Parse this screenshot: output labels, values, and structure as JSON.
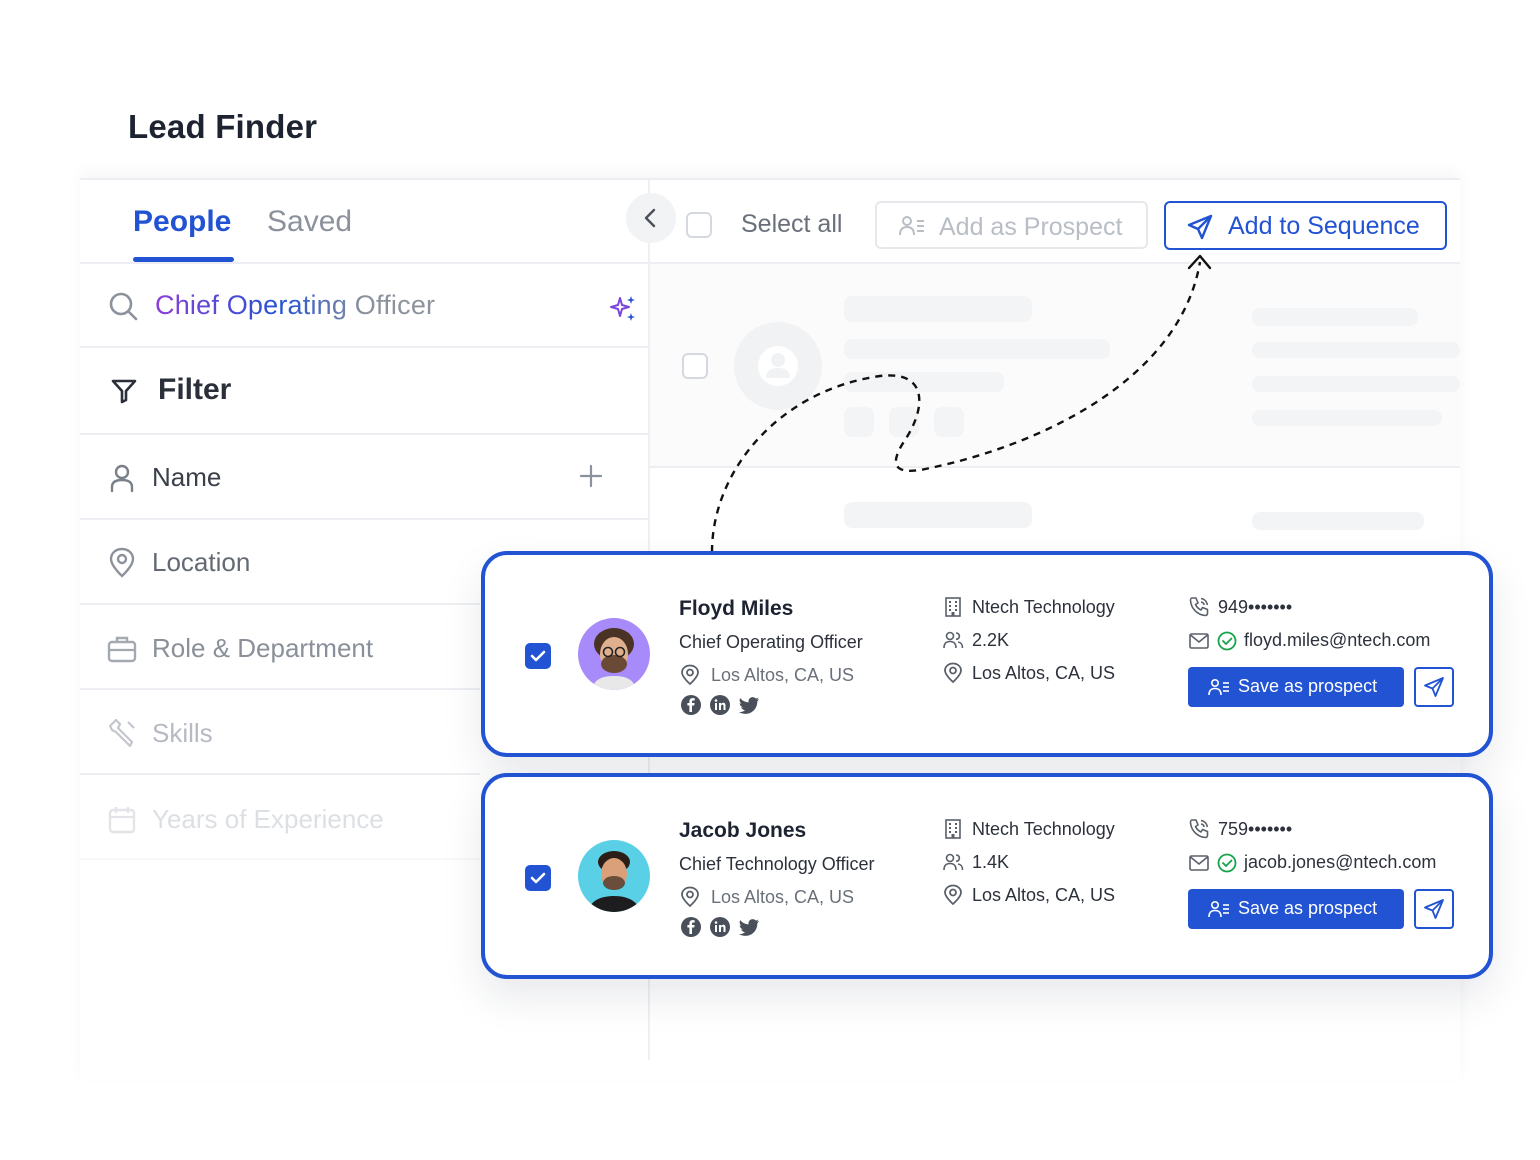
{
  "page": {
    "title": "Lead Finder"
  },
  "tabs": [
    {
      "label": "People",
      "active": true
    },
    {
      "label": "Saved",
      "active": false
    }
  ],
  "search": {
    "value": "Chief Operating Officer",
    "gradient_from": "#8b3fd9",
    "gradient_to": "#2253d3",
    "icon": "search-icon"
  },
  "filter": {
    "label": "Filter",
    "items": [
      {
        "label": "Name",
        "icon": "person-icon"
      },
      {
        "label": "Location",
        "icon": "location-pin-icon"
      },
      {
        "label": "Role & Department",
        "icon": "briefcase-icon"
      },
      {
        "label": "Skills",
        "icon": "tools-icon"
      },
      {
        "label": "Years of Experience",
        "icon": "calendar-icon"
      }
    ]
  },
  "toolbar": {
    "select_all": "Select all",
    "add_prospect": "Add as Prospect",
    "add_sequence": "Add to Sequence"
  },
  "leads": [
    {
      "name": "Floyd Miles",
      "title": "Chief Operating Officer",
      "location": "Los Altos, CA, US",
      "company": "Ntech Technology",
      "employees": "2.2K",
      "company_location": "Los Altos, CA, US",
      "phone": "949•••••••",
      "email": "floyd.miles@ntech.com",
      "save_label": "Save as prospect",
      "avatar_bg": "#a78bfa",
      "checked": true
    },
    {
      "name": "Jacob Jones",
      "title": "Chief Technology Officer",
      "location": "Los Altos, CA, US",
      "company": "Ntech Technology",
      "employees": "1.4K",
      "company_location": "Los Altos, CA, US",
      "phone": "759•••••••",
      "email": "jacob.jones@ntech.com",
      "save_label": "Save as prospect",
      "avatar_bg": "#5ad0e6",
      "checked": true
    }
  ],
  "colors": {
    "accent": "#2253d3",
    "verified": "#16a34a"
  }
}
